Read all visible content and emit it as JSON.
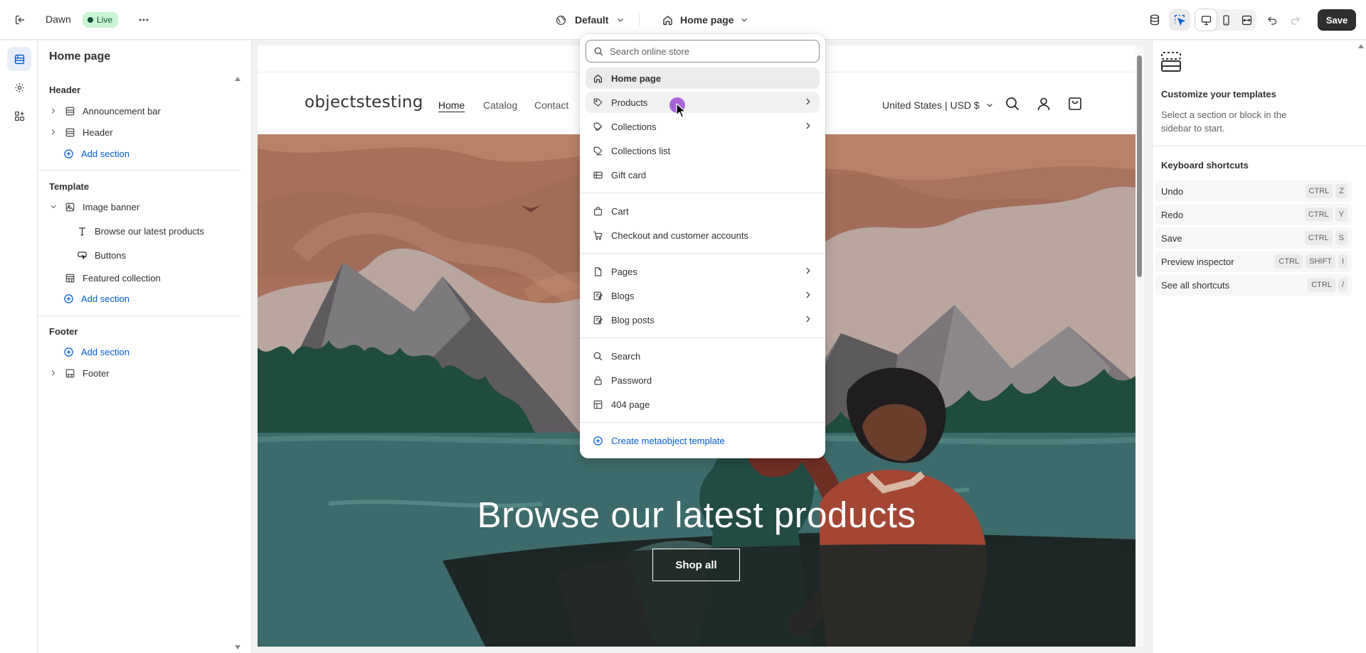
{
  "topbar": {
    "theme_name": "Dawn",
    "live_label": "Live",
    "default_label": "Default",
    "page_label": "Home page",
    "save_label": "Save"
  },
  "sidebar": {
    "title": "Home page",
    "header_group": "Header",
    "header_items": [
      "Announcement bar",
      "Header"
    ],
    "add_section": "Add section",
    "template_group": "Template",
    "template_items": {
      "image_banner": "Image banner",
      "browse": "Browse our latest products",
      "buttons": "Buttons",
      "featured": "Featured collection"
    },
    "footer_group": "Footer",
    "footer_item": "Footer"
  },
  "preview": {
    "logo": "objectstesting",
    "nav": [
      "Home",
      "Catalog",
      "Contact"
    ],
    "country": "United States | USD $",
    "banner_heading": "Browse our latest products",
    "shop_all": "Shop all"
  },
  "dropdown": {
    "search_placeholder": "Search online store",
    "items": {
      "home": "Home page",
      "products": "Products",
      "collections": "Collections",
      "collections_list": "Collections list",
      "gift_card": "Gift card",
      "cart": "Cart",
      "checkout": "Checkout and customer accounts",
      "pages": "Pages",
      "blogs": "Blogs",
      "blog_posts": "Blog posts",
      "search": "Search",
      "password": "Password",
      "404": "404 page"
    },
    "create": "Create metaobject template"
  },
  "right_panel": {
    "title": "Customize your templates",
    "description": "Select a section or block in the sidebar to start.",
    "kb_title": "Keyboard shortcuts",
    "shortcuts": [
      {
        "label": "Undo",
        "keys": [
          "CTRL",
          "Z"
        ]
      },
      {
        "label": "Redo",
        "keys": [
          "CTRL",
          "Y"
        ]
      },
      {
        "label": "Save",
        "keys": [
          "CTRL",
          "S"
        ]
      },
      {
        "label": "Preview inspector",
        "keys": [
          "CTRL",
          "SHIFT",
          "I"
        ]
      },
      {
        "label": "See all shortcuts",
        "keys": [
          "CTRL",
          "/"
        ]
      }
    ]
  },
  "colors": {
    "accent_blue": "#005bd3",
    "live_badge_bg": "#c8f5d4",
    "save_button_bg": "#303030",
    "cursor_highlight": "#9c4cd6"
  }
}
